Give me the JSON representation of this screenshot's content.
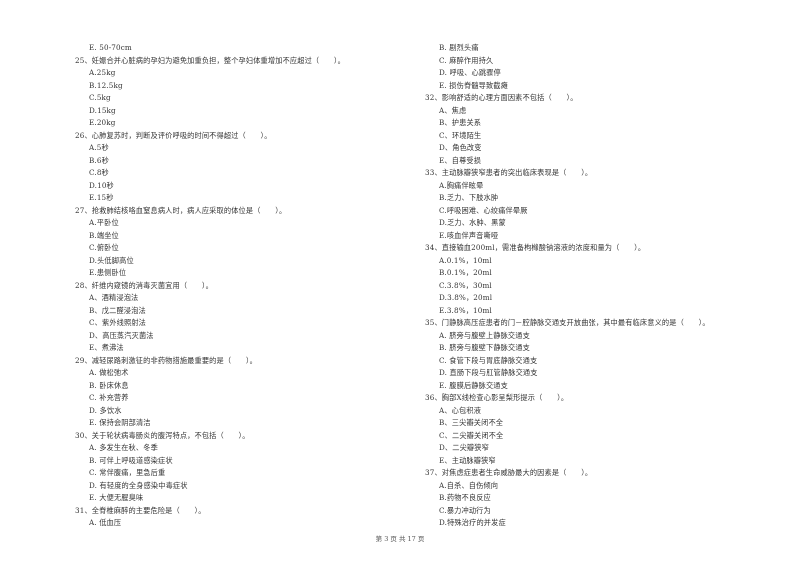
{
  "left_column": [
    {
      "type": "opt",
      "text": "E. 50-70cm"
    },
    {
      "type": "q",
      "text": "25、妊娠合并心脏病的孕妇为避免加重负担，整个孕妇体重增加不应超过（　　）。"
    },
    {
      "type": "opt",
      "text": "A.25kg"
    },
    {
      "type": "opt",
      "text": "B.12.5kg"
    },
    {
      "type": "opt",
      "text": "C.5kg"
    },
    {
      "type": "opt",
      "text": "D.15kg"
    },
    {
      "type": "opt",
      "text": "E.20kg"
    },
    {
      "type": "q",
      "text": "26、心肺复苏时，判断及评价呼吸的时间不得超过（　　）。"
    },
    {
      "type": "opt",
      "text": "A.5秒"
    },
    {
      "type": "opt",
      "text": "B.6秒"
    },
    {
      "type": "opt",
      "text": "C.8秒"
    },
    {
      "type": "opt",
      "text": "D.10秒"
    },
    {
      "type": "opt",
      "text": "E.15秒"
    },
    {
      "type": "q",
      "text": "27、抢救肺结核咯血窒息病人时，病人应采取的体位是（　　）。"
    },
    {
      "type": "opt",
      "text": "A.平卧位"
    },
    {
      "type": "opt",
      "text": "B.端坐位"
    },
    {
      "type": "opt",
      "text": "C.俯卧位"
    },
    {
      "type": "opt",
      "text": "D.头低脚高位"
    },
    {
      "type": "opt",
      "text": "E.患侧卧位"
    },
    {
      "type": "q",
      "text": "28、纤维内窥镜的消毒灭菌宜用（　　）。"
    },
    {
      "type": "opt",
      "text": "A、酒精浸泡法"
    },
    {
      "type": "opt",
      "text": "B、戊二醛浸泡法"
    },
    {
      "type": "opt",
      "text": "C、紫外线照射法"
    },
    {
      "type": "opt",
      "text": "D、高压蒸汽灭菌法"
    },
    {
      "type": "opt",
      "text": "E、煮沸法"
    },
    {
      "type": "q",
      "text": "29、减轻尿路刺激征的非药物措施最重要的是（　　）。"
    },
    {
      "type": "opt",
      "text": "A. 做松弛术"
    },
    {
      "type": "opt",
      "text": "B. 卧床休息"
    },
    {
      "type": "opt",
      "text": "C. 补充营养"
    },
    {
      "type": "opt",
      "text": "D. 多饮水"
    },
    {
      "type": "opt",
      "text": "E. 保持会阴部清洁"
    },
    {
      "type": "q",
      "text": "30、关于轮状病毒肠炎的腹泻特点，不包括（　　）。"
    },
    {
      "type": "opt",
      "text": "A. 多发生在秋、冬季"
    },
    {
      "type": "opt",
      "text": "B. 可伴上呼吸道感染症状"
    },
    {
      "type": "opt",
      "text": "C. 常伴腹痛，里急后重"
    },
    {
      "type": "opt",
      "text": "D. 有轻度的全身感染中毒症状"
    },
    {
      "type": "opt",
      "text": "E. 大便无腥臭味"
    },
    {
      "type": "q",
      "text": "31、全脊椎麻醉的主要危险是（　　）。"
    },
    {
      "type": "opt",
      "text": "A. 低血压"
    }
  ],
  "right_column": [
    {
      "type": "opt",
      "text": "B. 剧烈头痛"
    },
    {
      "type": "opt",
      "text": "C. 麻醉作用持久"
    },
    {
      "type": "opt",
      "text": "D. 呼吸、心跳骤停"
    },
    {
      "type": "opt",
      "text": "E. 损伤脊髓导致截瘫"
    },
    {
      "type": "q",
      "text": "32、影响舒适的心理方面因素不包括（　　）。"
    },
    {
      "type": "opt",
      "text": "A、焦虑"
    },
    {
      "type": "opt",
      "text": "B、护患关系"
    },
    {
      "type": "opt",
      "text": "C、环境陌生"
    },
    {
      "type": "opt",
      "text": "D、角色改变"
    },
    {
      "type": "opt",
      "text": "E、自尊受损"
    },
    {
      "type": "q",
      "text": "33、主动脉瓣狭窄患者的突出临床表现是（　　）。"
    },
    {
      "type": "opt",
      "text": "A.胸痛伴眩晕"
    },
    {
      "type": "opt",
      "text": "B.乏力、下肢水肿"
    },
    {
      "type": "opt",
      "text": "C.呼吸困难、心绞痛伴晕厥"
    },
    {
      "type": "opt",
      "text": "D.乏力、水肿、黑蒙"
    },
    {
      "type": "opt",
      "text": "E.咳血伴声音嘶哑"
    },
    {
      "type": "q",
      "text": "34、直接输血200ml，需准备枸橼酸钠溶液的浓度和量为（　　）。"
    },
    {
      "type": "opt",
      "text": "A.0.1%，10ml"
    },
    {
      "type": "opt",
      "text": "B.0.1%，20ml"
    },
    {
      "type": "opt",
      "text": "C.3.8%，30ml"
    },
    {
      "type": "opt",
      "text": "D.3.8%，20ml"
    },
    {
      "type": "opt",
      "text": "E.3.8%，10ml"
    },
    {
      "type": "q",
      "text": "35、门静脉高压症患者的门－腔静脉交通支开放曲张，其中最有临床意义的是（　　）。"
    },
    {
      "type": "opt",
      "text": "A. 脐旁与腹壁上静脉交通支"
    },
    {
      "type": "opt",
      "text": "B. 脐旁与腹壁下静脉交通支"
    },
    {
      "type": "opt",
      "text": "C. 食管下段与胃底静脉交通支"
    },
    {
      "type": "opt",
      "text": "D. 直肠下段与肛管静脉交通支"
    },
    {
      "type": "opt",
      "text": "E. 腹膜后静脉交通支"
    },
    {
      "type": "q",
      "text": "36、胸部X线检查心影呈梨形提示（　　）。"
    },
    {
      "type": "opt",
      "text": "A、心包积液"
    },
    {
      "type": "opt",
      "text": "B、三尖瓣关闭不全"
    },
    {
      "type": "opt",
      "text": "C、二尖瓣关闭不全"
    },
    {
      "type": "opt",
      "text": "D、二尖瓣狭窄"
    },
    {
      "type": "opt",
      "text": "E、主动脉瓣狭窄"
    },
    {
      "type": "q",
      "text": "37、对焦虑症患者生命威胁最大的因素是（　　）。"
    },
    {
      "type": "opt",
      "text": "A.自杀、自伤倾向"
    },
    {
      "type": "opt",
      "text": "B.药物不良反应"
    },
    {
      "type": "opt",
      "text": "C.暴力冲动行为"
    },
    {
      "type": "opt",
      "text": "D.特殊治疗的并发症"
    }
  ],
  "footer": {
    "page_label": "第 3 页 共 17 页"
  }
}
